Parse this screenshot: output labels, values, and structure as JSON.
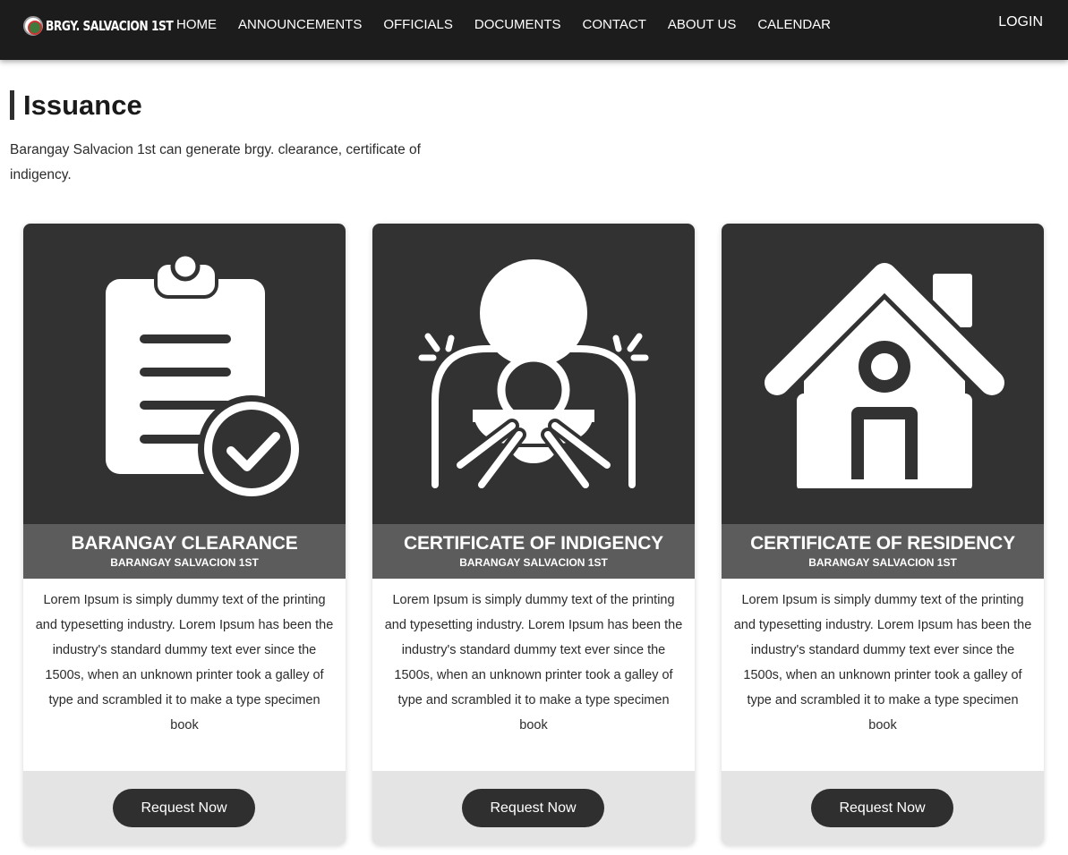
{
  "nav": {
    "brand": "BRGY. SALVACION 1ST",
    "links": [
      "HOME",
      "ANNOUNCEMENTS",
      "OFFICIALS",
      "DOCUMENTS",
      "CONTACT",
      "ABOUT US",
      "CALENDAR"
    ],
    "login": "LOGIN"
  },
  "page": {
    "title": "Issuance",
    "description": "Barangay Salvacion 1st can generate brgy. clearance, certificate of indigency."
  },
  "cards": [
    {
      "icon": "clipboard-check-icon",
      "title": "BARANGAY CLEARANCE",
      "subtitle": "BARANGAY SALVACION 1ST",
      "body": "Lorem Ipsum is simply dummy text of the printing and typesetting industry. Lorem Ipsum has been the industry's standard dummy text ever since the 1500s, when an unknown printer took a galley of type and scrambled it to make a type specimen book",
      "button": "Request Now"
    },
    {
      "icon": "person-begging-bowl-icon",
      "title": "CERTIFICATE OF INDIGENCY",
      "subtitle": "BARANGAY SALVACION 1ST",
      "body": "Lorem Ipsum is simply dummy text of the printing and typesetting industry. Lorem Ipsum has been the industry's standard dummy text ever since the 1500s, when an unknown printer took a galley of type and scrambled it to make a type specimen book",
      "button": "Request Now"
    },
    {
      "icon": "house-icon",
      "title": "CERTIFICATE OF RESIDENCY",
      "subtitle": "BARANGAY SALVACION 1ST",
      "body": "Lorem Ipsum is simply dummy text of the printing and typesetting industry. Lorem Ipsum has been the industry's standard dummy text ever since the 1500s, when an unknown printer took a galley of type and scrambled it to make a type specimen book",
      "button": "Request Now"
    }
  ],
  "colors": {
    "navbar": "#1c1c1c",
    "card_image_bg": "#323232",
    "card_header_bg": "#5c5c5c",
    "card_footer_bg": "#e4e4e4",
    "button_bg": "#2f2f2f"
  }
}
